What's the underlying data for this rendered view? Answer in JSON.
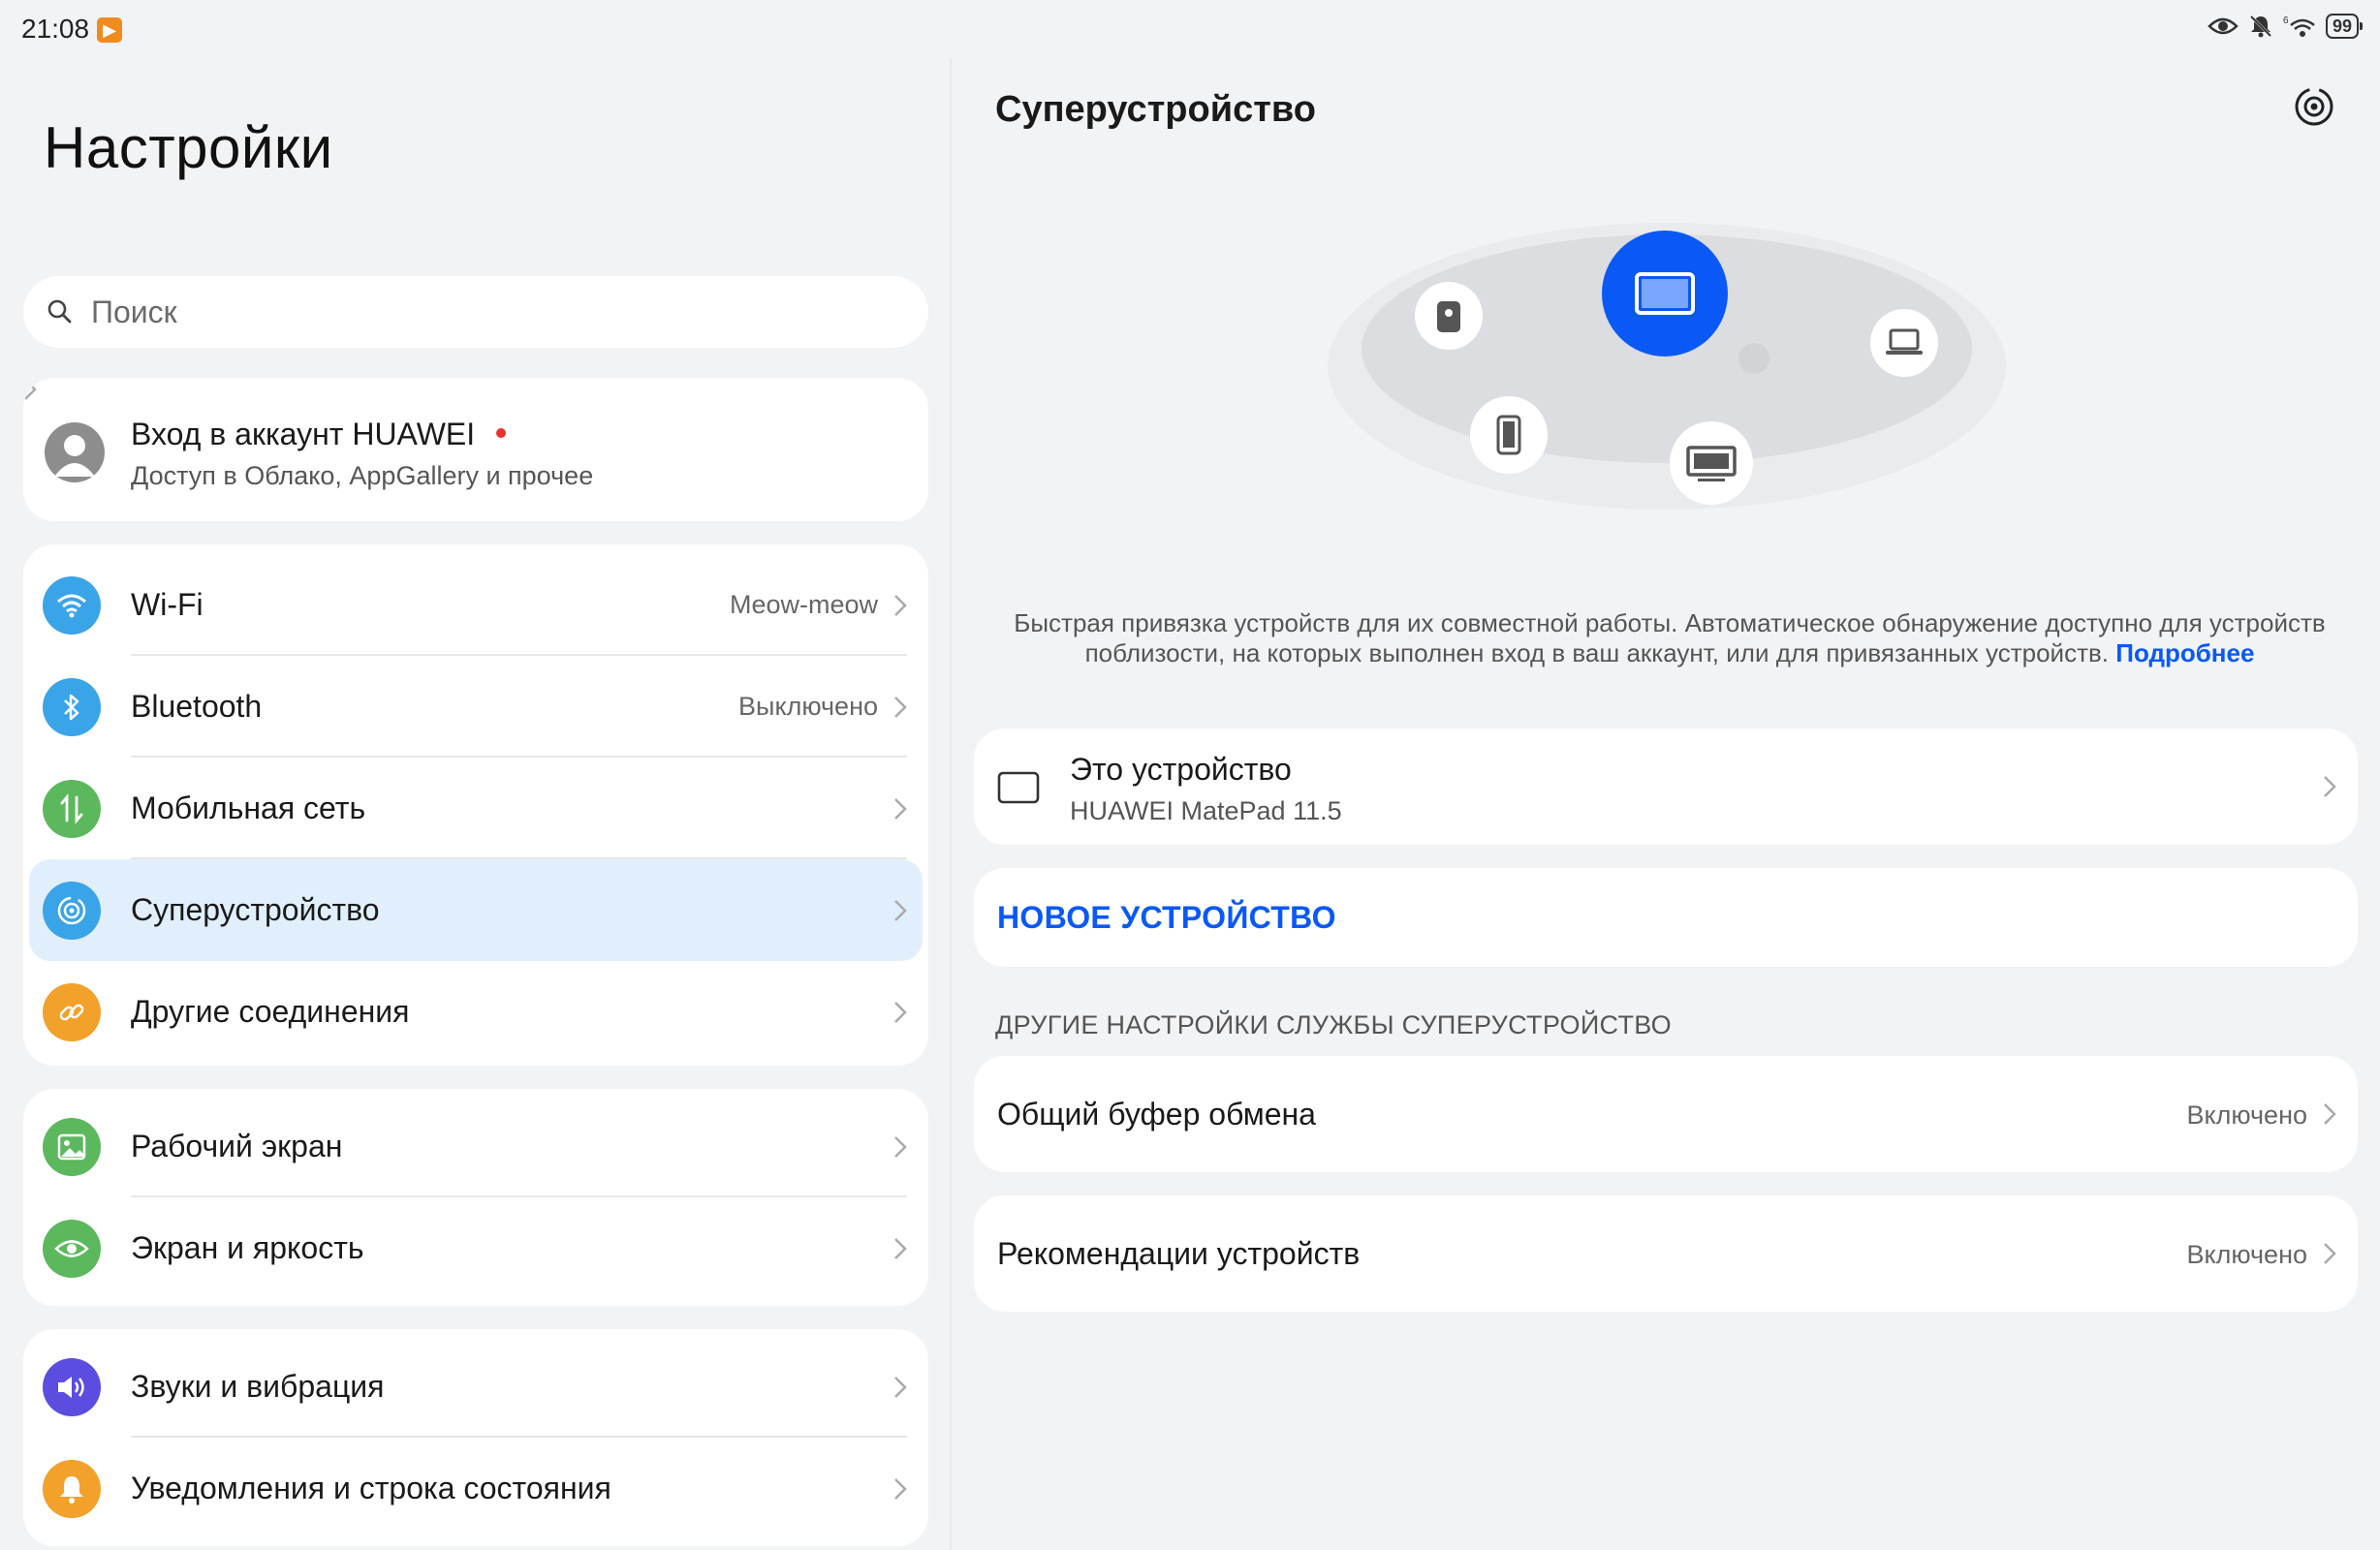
{
  "status_bar": {
    "time": "21:08",
    "battery": "99"
  },
  "left": {
    "title": "Настройки",
    "search_placeholder": "Поиск",
    "account": {
      "title": "Вход в аккаунт HUAWEI",
      "subtitle": "Доступ в Облако, AppGallery и прочее"
    },
    "group1": [
      {
        "label": "Wi-Fi",
        "value": "Meow-meow",
        "icon": "wifi-icon",
        "color": "#3aa4e8"
      },
      {
        "label": "Bluetooth",
        "value": "Выключено",
        "icon": "bluetooth-icon",
        "color": "#3aa4e8"
      },
      {
        "label": "Мобильная сеть",
        "value": "",
        "icon": "mobile-data-icon",
        "color": "#5cb85c"
      },
      {
        "label": "Суперустройство",
        "value": "",
        "icon": "superdevice-icon",
        "color": "#3aa4e8"
      },
      {
        "label": "Другие соединения",
        "value": "",
        "icon": "link-icon",
        "color": "#f2a12a"
      }
    ],
    "group2": [
      {
        "label": "Рабочий экран",
        "icon": "home-screen-icon",
        "color": "#5cb85c"
      },
      {
        "label": "Экран и яркость",
        "icon": "eye-icon",
        "color": "#5cb85c"
      }
    ],
    "group3": [
      {
        "label": "Звуки и вибрация",
        "icon": "sound-icon",
        "color": "#5a4de0"
      },
      {
        "label": "Уведомления и строка состояния",
        "icon": "bell-icon",
        "color": "#f2a12a"
      }
    ]
  },
  "right": {
    "title": "Суперустройство",
    "description": "Быстрая привязка устройств для их совместной работы. Автоматическое обнаружение доступно для устройств поблизости, на которых выполнен вход в ваш аккаунт, или для привязанных устройств.",
    "more_link": "Подробнее",
    "this_device": {
      "title": "Это устройство",
      "model": "HUAWEI MatePad 11.5"
    },
    "new_device": "НОВОЕ УСТРОЙСТВО",
    "section_header": "ДРУГИЕ НАСТРОЙКИ СЛУЖБЫ СУПЕРУСТРОЙСТВО",
    "clipboard": {
      "label": "Общий буфер обмена",
      "value": "Включено"
    },
    "recommendations": {
      "label": "Рекомендации устройств",
      "value": "Включено"
    }
  },
  "colors": {
    "accent": "#0a59f7",
    "selected_bg": "#e1effd",
    "background": "#f1f3f5"
  }
}
